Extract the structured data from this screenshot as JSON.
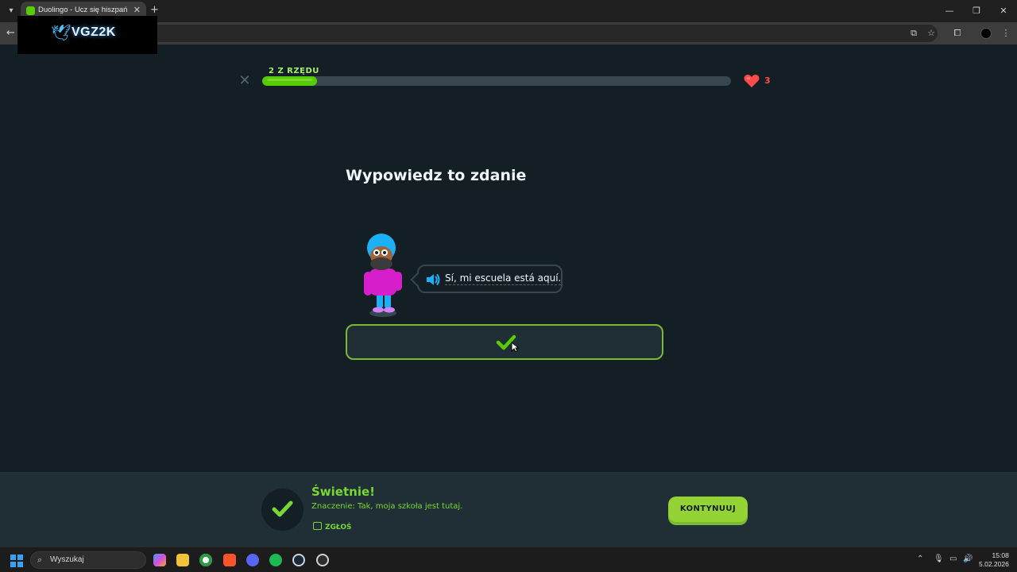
{
  "browser": {
    "tab_title": "Duolingo - Ucz się hiszpańskiego",
    "tab_close": "✕",
    "new_tab": "+",
    "window_controls": [
      "—",
      "❐",
      "✕"
    ]
  },
  "watermark": {
    "text": "VGZ2K"
  },
  "lesson": {
    "streak_label": "2 Z RZĘDU",
    "progress_fraction": 0.117,
    "hearts": "3",
    "prompt_title": "Wypowiedz to zdanie",
    "sentence": "Sí, mi escuela está aquí."
  },
  "feedback": {
    "title": "Świetnie!",
    "meaning": "Znaczenie: Tak, moja szkoła jest tutaj.",
    "report_label": "ZGŁOŚ",
    "continue_label": "KONTYNUUJ"
  },
  "taskbar": {
    "search_placeholder": "Wyszukaj",
    "time": "15:08",
    "date": "5.02.2026"
  },
  "colors": {
    "background": "#131f24",
    "accent_green": "#58cc02",
    "success_green": "#79d634",
    "heart_red": "#ff4b4b",
    "button_green": "#93d333"
  }
}
